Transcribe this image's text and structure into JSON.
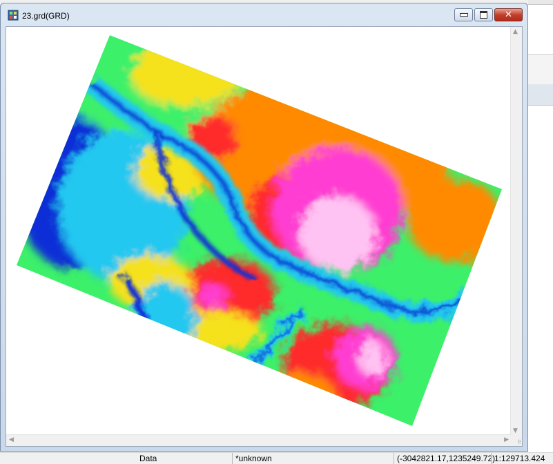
{
  "window": {
    "title": "23.grd(GRD)",
    "icon": "grid-file-icon"
  },
  "titlebar_buttons": {
    "minimize_icon": "minimize-icon",
    "maximize_icon": "maximize-icon",
    "close_icon": "close-icon",
    "close_glyph": "✕"
  },
  "map": {
    "layer": "elevation-grid-raster",
    "colors": {
      "low": "#0a2fd6",
      "low_mid": "#22c8f0",
      "mid": "#3cf06a",
      "mid_high": "#f5e11e",
      "high": "#ff8a00",
      "higher": "#ff2a2a",
      "peak": "#ff3cd2",
      "top": "#ffc3f3"
    }
  },
  "scrollbars": {
    "up_glyph": "▲",
    "down_glyph": "▼",
    "left_glyph": "◀",
    "right_glyph": "▶",
    "grip_glyph": "⠿"
  },
  "statusbar": {
    "mode": "Data",
    "projection": "*unknown",
    "coordinates": "(-3042821.17,1235249.72)",
    "scale": "1:129713.424"
  }
}
